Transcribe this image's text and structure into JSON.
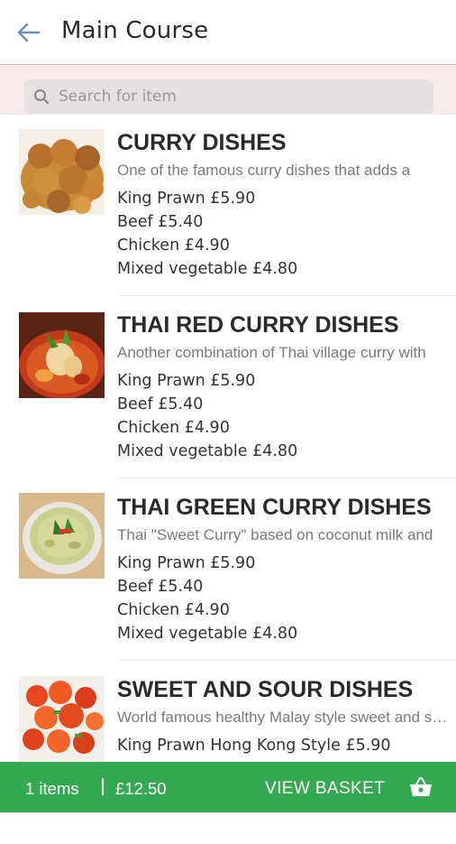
{
  "header": {
    "title": "Main Course",
    "back_icon": "arrow-left-icon"
  },
  "search": {
    "placeholder": "Search for item",
    "value": ""
  },
  "items": [
    {
      "title": "CURRY DISHES",
      "description": "One of the famous curry dishes that adds a",
      "prices": [
        "King Prawn £5.90",
        "Beef £5.40",
        "Chicken £4.90",
        "Mixed vegetable £4.80"
      ]
    },
    {
      "title": "THAI RED CURRY DISHES",
      "description": "Another combination of Thai village curry with",
      "prices": [
        "King Prawn £5.90",
        "Beef £5.40",
        "Chicken £4.90",
        "Mixed vegetable £4.80"
      ]
    },
    {
      "title": "THAI GREEN CURRY DISHES",
      "description": "Thai \"Sweet Curry\" based on coconut milk and",
      "prices": [
        "King Prawn £5.90",
        "Beef £5.40",
        "Chicken £4.90",
        "Mixed vegetable £4.80"
      ]
    },
    {
      "title": "SWEET AND SOUR DISHES",
      "description": "World famous healthy Malay style sweet and sour",
      "prices": [
        "King Prawn Hong Kong Style £5.90"
      ]
    }
  ],
  "basket": {
    "count_label": "1 items",
    "total": "£12.50",
    "view_label": "VIEW BASKET",
    "icon": "basket-icon"
  },
  "colors": {
    "accent_green": "#34a853",
    "header_border": "#e3a9ad",
    "search_band": "#f8e9ea",
    "back_arrow": "#6a8fb5"
  }
}
